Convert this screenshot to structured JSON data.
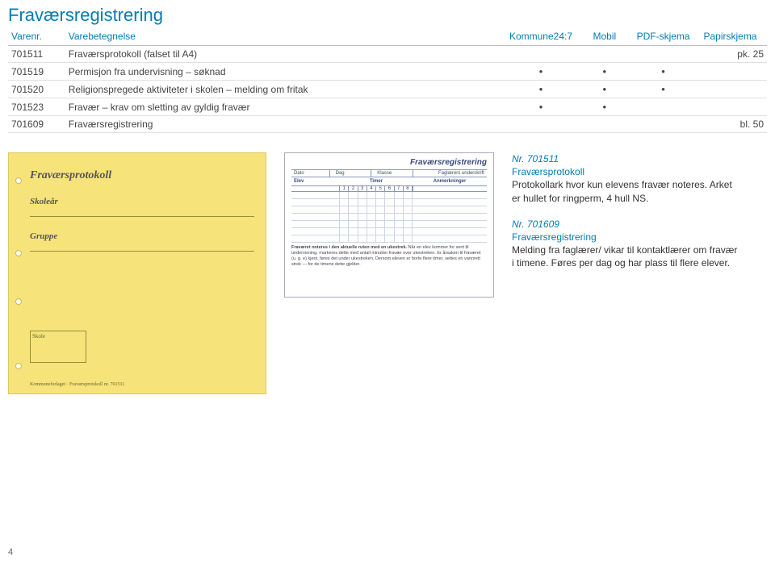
{
  "page_title": "Fraværsregistrering",
  "header": {
    "varenr": "Varenr.",
    "varebetegnelse": "Varebetegnelse",
    "kommune": "Kommune24:7",
    "mobil": "Mobil",
    "pdf": "PDF-skjema",
    "papir": "Papirskjema"
  },
  "rows": [
    {
      "nr": "701511",
      "desc": "Fraværsprotokoll (falset til A4)",
      "k": "",
      "m": "",
      "p": "",
      "pp": "pk. 25"
    },
    {
      "nr": "701519",
      "desc": "Permisjon fra undervisning – søknad",
      "k": "•",
      "m": "•",
      "p": "•",
      "pp": ""
    },
    {
      "nr": "701520",
      "desc": "Religionspregede aktiviteter i skolen – melding om fritak",
      "k": "•",
      "m": "•",
      "p": "•",
      "pp": ""
    },
    {
      "nr": "701523",
      "desc": "Fravær – krav om sletting av gyldig fravær",
      "k": "•",
      "m": "•",
      "p": "",
      "pp": ""
    },
    {
      "nr": "701609",
      "desc": "Fraværsregistrering",
      "k": "",
      "m": "",
      "p": "",
      "pp": "bl. 50"
    }
  ],
  "yellow": {
    "title": "Fraværsprotokoll",
    "label1": "Skoleår",
    "label2": "Gruppe",
    "boxlabel": "Skole",
    "bottom": "Kommuneforlaget · Fraværsprotokoll nr. 701511"
  },
  "white": {
    "title": "Fraværsregistrering",
    "dato": "Dato",
    "dag": "Dag",
    "klasse": "Klasse",
    "signert": "Faglærers underskrift",
    "elev": "Elev",
    "timer": "Timer",
    "anm": "Anmerkninger",
    "nums": [
      "1",
      "2",
      "3",
      "4",
      "5",
      "6",
      "7",
      "8"
    ],
    "note_bold": "Fraværet noteres i den aktuelle ruten med en ukestrek.",
    "note_rest": "Når en elev kommer for sent til undervisning, markeres dette med antall minutter fravær over ukestreken. Er årsaken til fraværet (u. g. e) kjent, føres det under ukestreken. Dersom eleven er borte flere timer, settes en vannrett strek — for de timene dette gjelder."
  },
  "right": {
    "p1_nr": "Nr. 701511",
    "p1_bold": "Fraværsprotokoll",
    "p1_rest": "Protokollark hvor kun elevens fravær noteres. Arket er hullet for ringperm, 4 hull NS.",
    "p2_nr": "Nr. 701609",
    "p2_bold": "Fraværsregistrering",
    "p2_rest": "Melding fra faglærer/ vikar til kontaktlærer om fravær i timene. Føres per dag og har plass til flere elever."
  },
  "page_number": "4"
}
